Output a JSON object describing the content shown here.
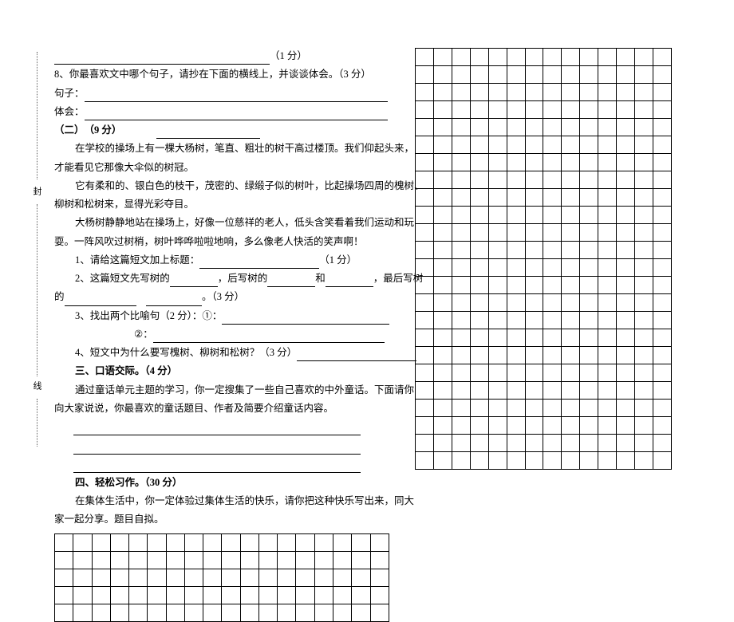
{
  "top_score_hint": "（1 分）",
  "q8": "8、你最喜欢文中哪个句子，请抄在下面的横线上，并谈谈体会。（3 分）",
  "q8_sentence_label": "句子：",
  "q8_feel_label": "体会：",
  "section2": "（二）　（9 分）",
  "para1a": "在学校的操场上有一棵大杨树，笔直、粗壮的树干高过楼顶。我们仰起头来，",
  "para1b": "才能看见它那像大伞似的树冠。",
  "para2a": "它有柔和的、银白色的枝干，茂密的、绿缎子似的树叶，比起操场四周的槐树、",
  "para2b": "柳树和松树来，显得光彩夺目。",
  "para3a": "大杨树静静地站在操场上，好像一位慈祥的老人，低头含笑看着我们运动和玩",
  "para3b": "耍。一阵风吹过树梢，树叶哗哗啦啦地响，多么像老人快活的笑声啊！",
  "q2_1a": "1、请给这篇短文加上标题：",
  "q2_1b": "（1 分）",
  "q2_2a": "2、这篇短文先写树的",
  "q2_2b": "，后写树的",
  "q2_2c": "和",
  "q2_2d": "，最后写树",
  "q2_2e": "的",
  "q2_2f": "。（3 分）",
  "q2_3a": "3、找出两个比喻句（2 分）：①：",
  "q2_3b": "②：",
  "q2_4": "4、短文中为什么要写槐树、柳树和松树？（3 分）",
  "section3": "三、口语交际。（4 分）",
  "sec3_a": "通过童话单元主题的学习，你一定搜集了一些自己喜欢的中外童话。下面请你",
  "sec3_b": "向大家说说，你最喜欢的童话题目、作者及简要介绍童话内容。",
  "section4": "四、轻松习作。（30 分）",
  "sec4_a": "在集体生活中，你一定体验过集体生活的快乐，请你把这种快乐写出来，同大",
  "sec4_b": "家一起分享。题目自拟。",
  "fold1": "封",
  "fold2": "线"
}
